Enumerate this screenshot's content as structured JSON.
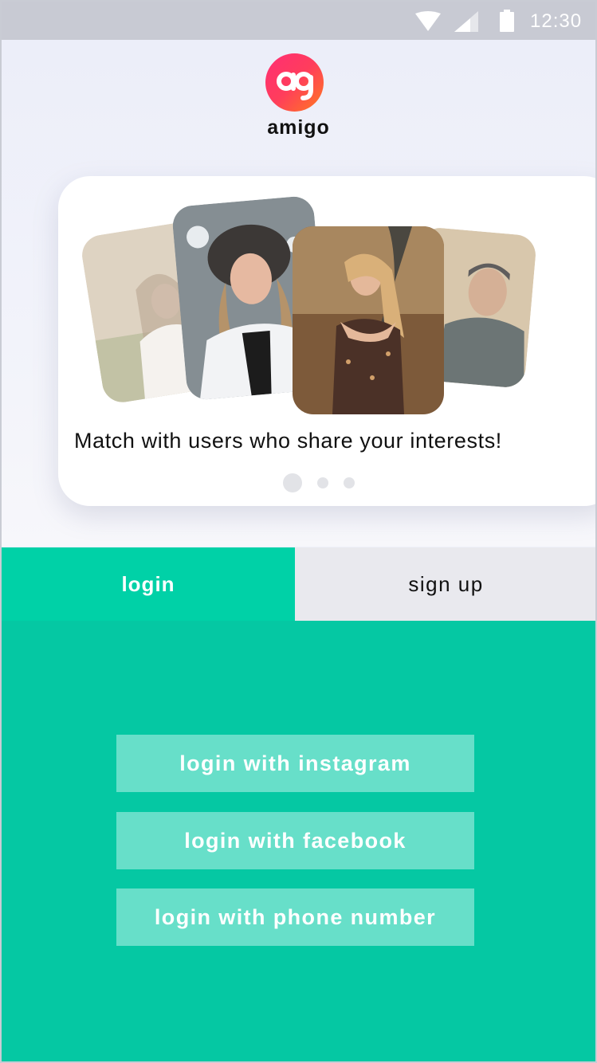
{
  "status_bar": {
    "time": "12:30"
  },
  "app": {
    "name": "amigo",
    "logo_glyph": "ag",
    "brand_gradient": [
      "#ff2e74",
      "#ff7a1e"
    ]
  },
  "carousel": {
    "caption": "Match with users who share your interests!",
    "page_count": 3,
    "active_page": 1
  },
  "tabs": {
    "login": "login",
    "signup": "sign up",
    "active": "login"
  },
  "login_options": [
    {
      "label": "login with instagram"
    },
    {
      "label": "login with facebook"
    },
    {
      "label": "login with phone number"
    }
  ],
  "colors": {
    "accent": "#05c8a3",
    "tab_active": "#00d1a7",
    "button": "#67dfc9"
  }
}
